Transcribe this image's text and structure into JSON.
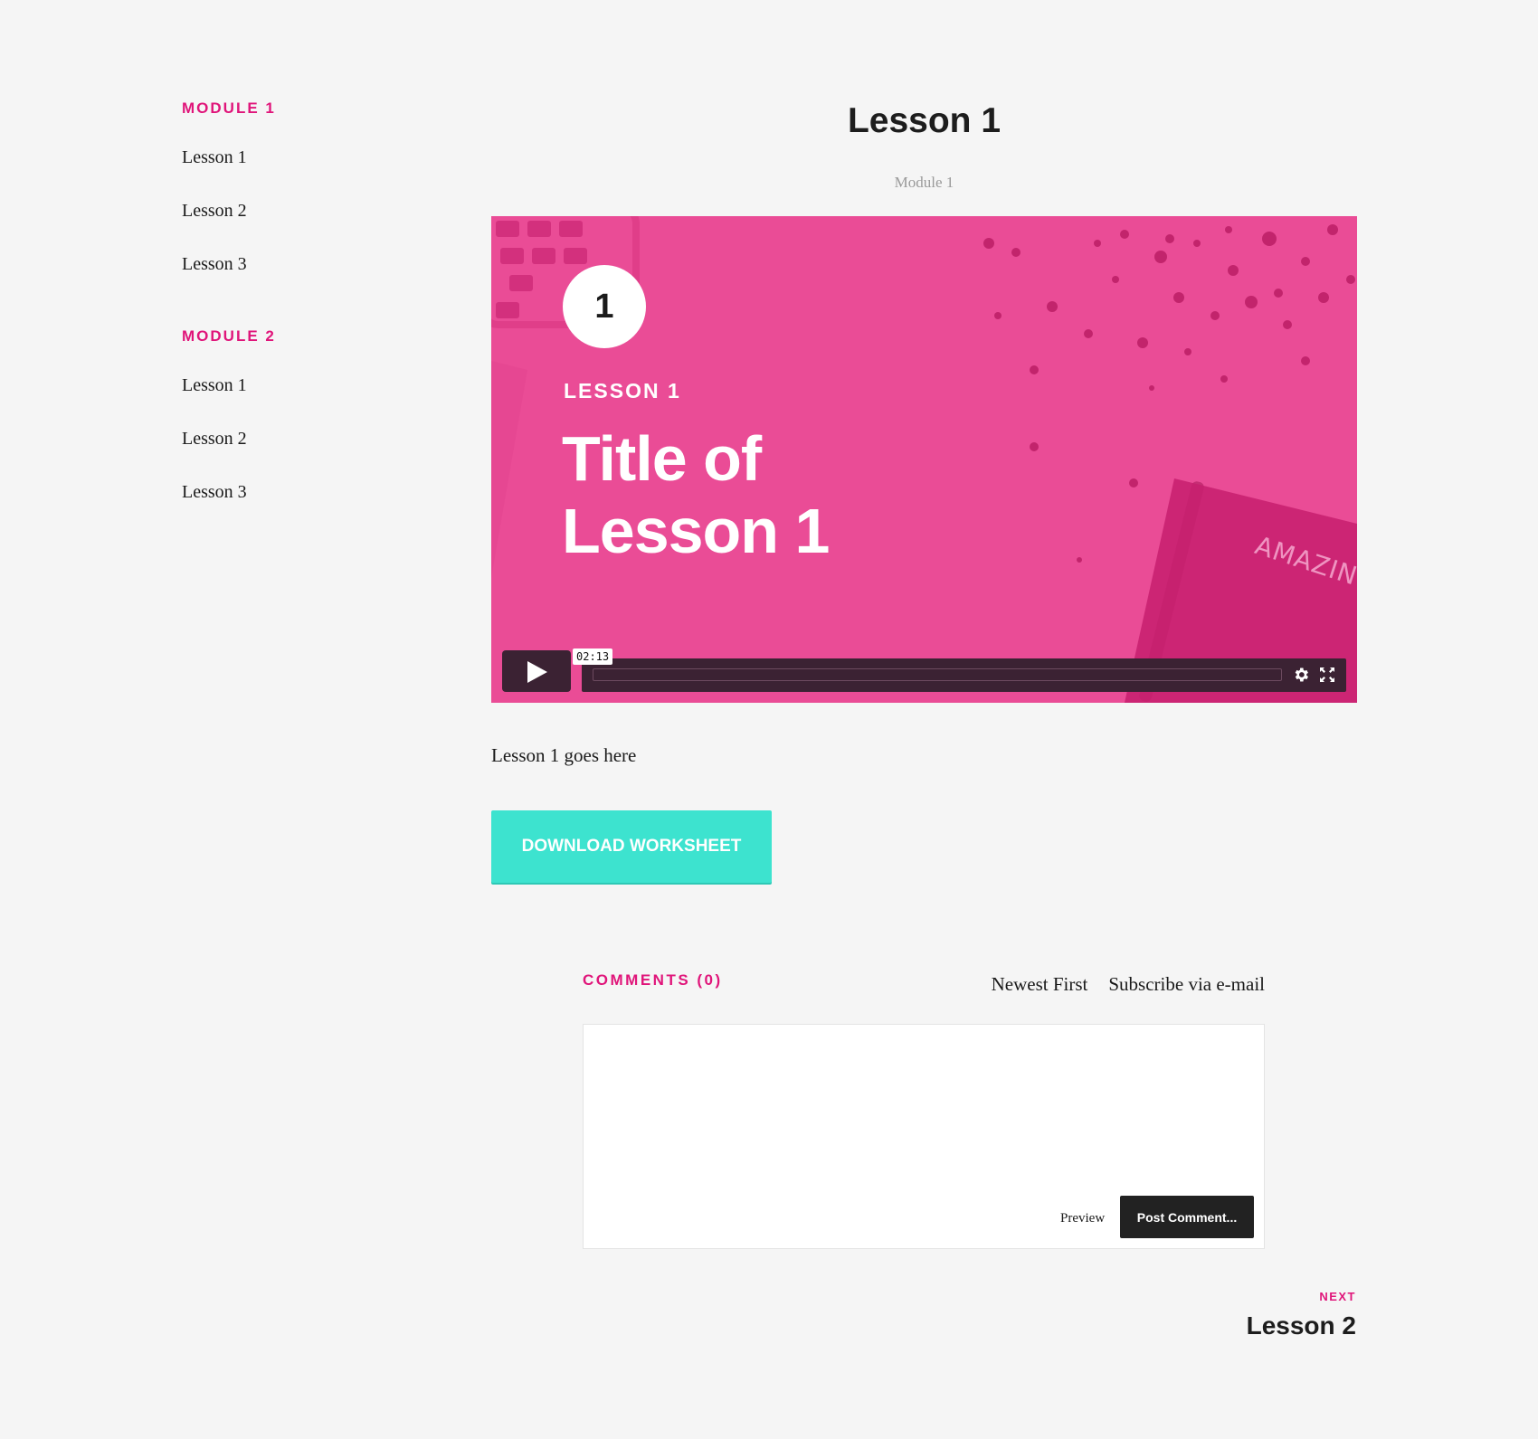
{
  "sidebar": {
    "modules": [
      {
        "heading": "MODULE 1",
        "lessons": [
          "Lesson 1",
          "Lesson 2",
          "Lesson 3"
        ]
      },
      {
        "heading": "MODULE 2",
        "lessons": [
          "Lesson 1",
          "Lesson 2",
          "Lesson 3"
        ]
      }
    ]
  },
  "page": {
    "title": "Lesson 1",
    "subtitle": "Module 1"
  },
  "video": {
    "number": "1",
    "eyebrow": "LESSON 1",
    "title_line1": "Title of",
    "title_line2": "Lesson 1",
    "notebook_text": "AMAZING",
    "time": "02:13",
    "progress": 0,
    "icons": [
      "play-icon",
      "settings-icon",
      "fullscreen-icon"
    ],
    "accent_color": "#ea4c96"
  },
  "content": {
    "body": "Lesson 1 goes here",
    "download_label": "DOWNLOAD WORKSHEET"
  },
  "comments": {
    "heading": "COMMENTS (0)",
    "sort_label": "Newest First",
    "subscribe_label": "Subscribe via e-mail",
    "input_value": "",
    "preview_label": "Preview",
    "post_label": "Post Comment..."
  },
  "next": {
    "label": "NEXT",
    "title": "Lesson 2"
  },
  "colors": {
    "brand_pink": "#e0157a",
    "teal": "#3de3cf",
    "background": "#f5f5f5"
  }
}
